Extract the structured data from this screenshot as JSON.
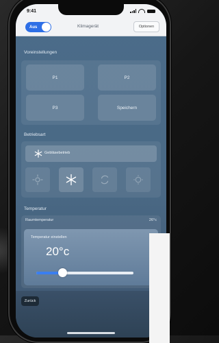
{
  "status": {
    "time": "9:41"
  },
  "header": {
    "power_toggle_label": "Aus",
    "title": "Klimagerät",
    "options_button": "Optionen"
  },
  "presets": {
    "title": "Voreinstellungen",
    "buttons": [
      "P1",
      "P2",
      "P3",
      "Speichern"
    ]
  },
  "mode": {
    "title": "Betriebsart",
    "current_label": "Gebläsebetrieb",
    "buttons": [
      {
        "icon": "heat-icon"
      },
      {
        "icon": "snowflake-icon"
      },
      {
        "icon": "auto-cycle-icon"
      },
      {
        "icon": "sun-icon"
      }
    ]
  },
  "temperature": {
    "title": "Temperatur",
    "room_label": "Raumtemperatur",
    "room_value": "26°c",
    "card_label": "Temperatur einstellen",
    "value": "20°c",
    "slider_fraction": 0.27
  },
  "footer": {
    "back_button": "Zurück"
  },
  "colors": {
    "accent": "#2e6fe6",
    "screen_bg": "#4b6c8a",
    "header_bg": "#f2f3f5"
  }
}
